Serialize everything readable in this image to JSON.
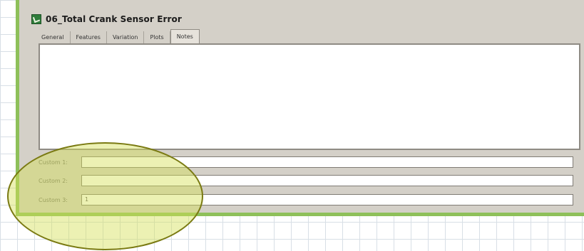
{
  "window": {
    "title": "06_Total Crank Sensor Error"
  },
  "tabs": [
    {
      "label": "General"
    },
    {
      "label": "Features"
    },
    {
      "label": "Variation"
    },
    {
      "label": "Plots"
    },
    {
      "label": "Notes",
      "active": true
    }
  ],
  "custom_fields": [
    {
      "label": "Custom 1:",
      "value": ""
    },
    {
      "label": "Custom 2:",
      "value": ""
    },
    {
      "label": "Custom 3:",
      "value": "1"
    }
  ],
  "colors": {
    "window_border": "#8ec05a",
    "highlight_fill": "#d5df57",
    "highlight_stroke": "#7a7a12"
  },
  "icons": {
    "app": "app-window-icon"
  }
}
